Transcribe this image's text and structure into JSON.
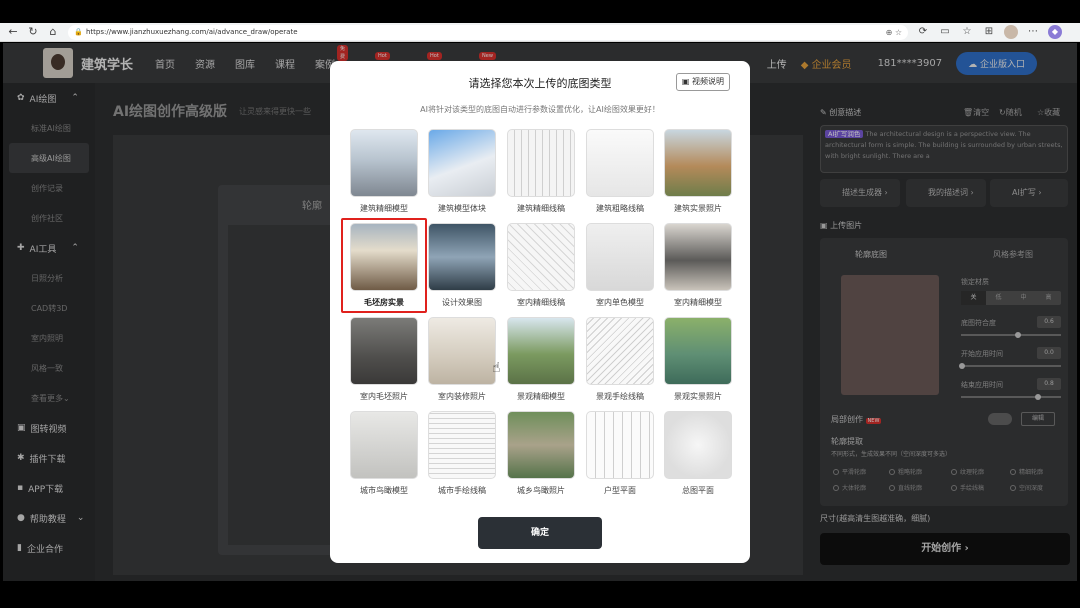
{
  "browser": {
    "url": "https://www.jianzhuxuezhang.com/ai/advance_draw/operate"
  },
  "site": {
    "name": "建筑学长",
    "nav": [
      {
        "label": "首页",
        "badge": ""
      },
      {
        "label": "资源",
        "badge": ""
      },
      {
        "label": "图库",
        "badge": ""
      },
      {
        "label": "课程",
        "badge": ""
      },
      {
        "label": "案例",
        "badge": "免费"
      },
      {
        "label": "",
        "badge": "Hot"
      },
      {
        "label": "",
        "badge": "Hot"
      },
      {
        "label": "",
        "badge": "New"
      }
    ],
    "upload": "上传",
    "vip": "企业会员",
    "phone": "181****3907",
    "enterprise": "企业版入口"
  },
  "sidebar": {
    "sections": [
      {
        "title": "AI绘图",
        "items": [
          "标准AI绘图",
          "高级AI绘图",
          "创作记录",
          "创作社区"
        ],
        "active": "高级AI绘图"
      },
      {
        "title": "AI工具",
        "items": [
          "日照分析",
          "CAD转3D",
          "室内照明",
          "风格一致",
          "查看更多"
        ]
      },
      {
        "title": "图转视频",
        "items": []
      },
      {
        "title": "插件下载",
        "items": []
      },
      {
        "title": "APP下载",
        "items": []
      },
      {
        "title": "帮助教程",
        "items": []
      },
      {
        "title": "企业合作",
        "items": []
      }
    ]
  },
  "main": {
    "title": "AI绘图创作高级版",
    "subtitle": "让灵感来得更快一些",
    "canvas_label": "轮廓"
  },
  "right_panel": {
    "desc_title": "创意描述",
    "clear": "清空",
    "random": "随机",
    "collect": "收藏",
    "ai_expand_tag": "AI扩写润色",
    "prompt": "The architectural design is a perspective view. The architectural form is simple. The building is surrounded by urban streets, with bright sunlight. There are a",
    "btn_gen": "描述生成器",
    "btn_mine": "我的描述词",
    "btn_ai": "AI扩写",
    "upload_title": "上传图片",
    "tab_outline": "轮廓底图",
    "tab_style": "风格参考图",
    "lock_material": "锁定材质",
    "mat_opts": [
      "关",
      "低",
      "中",
      "高"
    ],
    "overlap": "底图符合度",
    "overlap_val": "0.6",
    "start_time": "开始应用时间",
    "start_val": "0.0",
    "end_time": "结束应用时间",
    "end_val": "0.8",
    "local": "局部创作",
    "new": "NEW",
    "edit": "编辑",
    "extract": "轮廓提取",
    "extract_sub": "不同形式，生成效果不同（空间深度可多选）",
    "options": [
      "平滑轮廓",
      "粗略轮廓",
      "纹理轮廓",
      "精细轮廓",
      "大体轮廓",
      "直线轮廓",
      "手绘线稿",
      "空间深度"
    ],
    "size": "尺寸(越高清生图越准确，细腻)",
    "start": "开始创作"
  },
  "modal": {
    "title": "请选择您本次上传的底图类型",
    "video": "视频说明",
    "subtitle": "AI将针对该类型的底图自动进行参数设置优化，让AI绘图效果更好！",
    "types": [
      "建筑精细模型",
      "建筑模型体块",
      "建筑精细线稿",
      "建筑粗略线稿",
      "建筑实景照片",
      "毛坯房实景",
      "设计效果图",
      "室内精细线稿",
      "室内单色模型",
      "室内精细模型",
      "室内毛坯照片",
      "室内装修照片",
      "景观精细模型",
      "景观手绘线稿",
      "景观实景照片",
      "城市鸟瞰模型",
      "城市手绘线稿",
      "城乡鸟瞰照片",
      "户型平面",
      "总图平面"
    ],
    "selected_index": 5,
    "confirm": "确定"
  },
  "colors": {
    "highlight": "#e0211d",
    "confirm_bg": "#2b3036",
    "enterprise": "#2f6fc9",
    "vip": "#e6a23c"
  }
}
